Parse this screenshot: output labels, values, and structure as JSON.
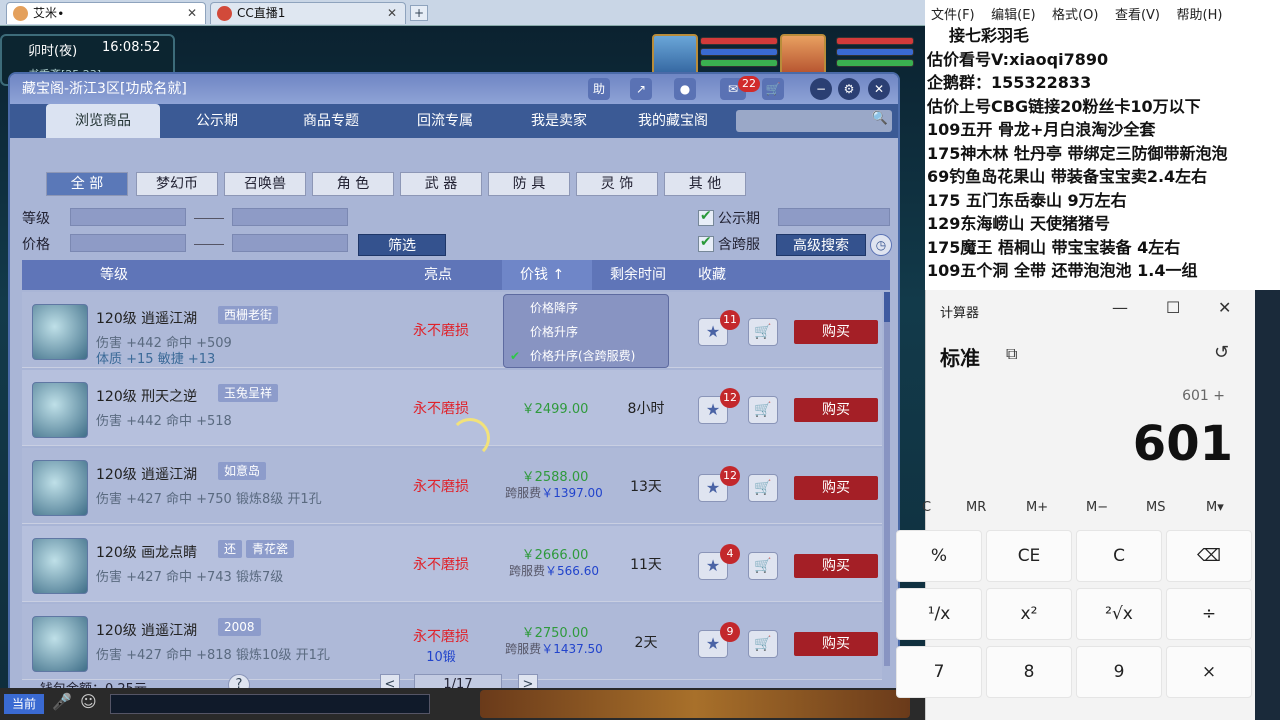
{
  "browser": {
    "tabs": [
      {
        "label": "艾米∙"
      },
      {
        "label": "CC直播1"
      }
    ],
    "add_tab": "+"
  },
  "hud": {
    "time_period": "卯时(夜)",
    "clock": "16:08:52",
    "location": "书香斋[25,23]"
  },
  "panel": {
    "title": "藏宝阁-浙江3区[功成名就]",
    "controls": {
      "help": "助",
      "mail_count": "22"
    },
    "tabs": [
      "浏览商品",
      "公示期",
      "商品专题",
      "回流专属",
      "我是卖家",
      "我的藏宝阁"
    ],
    "categories": [
      "全 部",
      "梦幻币",
      "召唤兽",
      "角 色",
      "武 器",
      "防 具",
      "灵 饰",
      "其 他"
    ],
    "filters": {
      "level_label": "等级",
      "price_label": "价格",
      "filter_button": "筛选",
      "public_label": "公示期",
      "cross_label": "含跨服",
      "advanced_button": "高级搜索"
    },
    "table_headers": {
      "level": "等级",
      "highlight": "亮点",
      "price": "价钱",
      "remaining": "剩余时间",
      "favorite": "收藏"
    },
    "sort_menu": [
      "价格降序",
      "价格升序",
      "价格升序(含跨服费)"
    ],
    "buy_label": "购买",
    "items": [
      {
        "name": "120级 逍遥江湖",
        "tag": "西栅老街",
        "attr": "伤害 +442 命中 +509",
        "attr2": "体质 +15 敏捷 +13",
        "highlight": "永不磨损",
        "highlight2": "",
        "price": "",
        "cross_fee": "",
        "cross_value": "",
        "remaining": "",
        "fav_count": "11"
      },
      {
        "name": "120级 刑天之逆",
        "tag": "玉兔呈祥",
        "attr": "伤害 +442 命中 +518",
        "attr2": "",
        "highlight": "永不磨损",
        "highlight2": "",
        "price": "￥2499.00",
        "cross_fee": "",
        "cross_value": "",
        "remaining": "8小时",
        "fav_count": "12"
      },
      {
        "name": "120级 逍遥江湖",
        "tag": "如意岛",
        "attr": "伤害 +427 命中 +750 锻炼8级 开1孔",
        "attr2": "",
        "highlight": "永不磨损",
        "highlight2": "",
        "price": "￥2588.00",
        "cross_fee": "跨服费",
        "cross_value": "￥1397.00",
        "remaining": "13天",
        "fav_count": "12"
      },
      {
        "name": "120级 画龙点睛",
        "tag": "青花瓷",
        "tag_prefix": "还",
        "attr": "伤害 +427 命中 +743 锻炼7级",
        "attr2": "",
        "highlight": "永不磨损",
        "highlight2": "",
        "price": "￥2666.00",
        "cross_fee": "跨服费",
        "cross_value": "￥566.60",
        "remaining": "11天",
        "fav_count": "4"
      },
      {
        "name": "120级 逍遥江湖",
        "tag": "2008",
        "attr": "伤害 +427 命中 +818 锻炼10级 开1孔",
        "attr2": "",
        "highlight": "永不磨损",
        "highlight2": "10锻",
        "price": "￥2750.00",
        "cross_fee": "跨服费",
        "cross_value": "￥1437.50",
        "remaining": "2天",
        "fav_count": "9"
      }
    ],
    "footer": {
      "wallet": "钱包余额：0.25元",
      "help": "?",
      "page": "1/17",
      "prev": "<",
      "next": ">"
    }
  },
  "taskbar": {
    "current": "当前"
  },
  "notepad": {
    "menu": [
      "文件(F)",
      "编辑(E)",
      "格式(O)",
      "查看(V)",
      "帮助(H)"
    ],
    "lines": [
      "接七彩羽毛",
      "估价看号V:xiaoqi7890",
      "企鹅群：155322833",
      "估价上号CBG链接20粉丝卡10万以下",
      "109五开 骨龙+月白浪淘沙全套",
      "175神木林 牡丹亭  带绑定三防御带新泡泡",
      "69钓鱼岛花果山 带装备宝宝卖2.4左右",
      "175 五门东岳泰山  9万左右",
      "129东海崂山 天使猪猪号",
      "175魔王 梧桐山  带宝宝装备 4左右",
      "109五个洞 全带 还带泡泡池  1.4一组"
    ]
  },
  "calculator": {
    "title": "计算器",
    "mode": "标准",
    "expression": "601 +",
    "display": "601",
    "memory": [
      "C",
      "MR",
      "M+",
      "M−",
      "MS",
      "M▾"
    ],
    "keys": [
      "%",
      "CE",
      "C",
      "⌫",
      "¹/x",
      "x²",
      "²√x",
      "÷",
      "7",
      "8",
      "9",
      "×"
    ]
  }
}
